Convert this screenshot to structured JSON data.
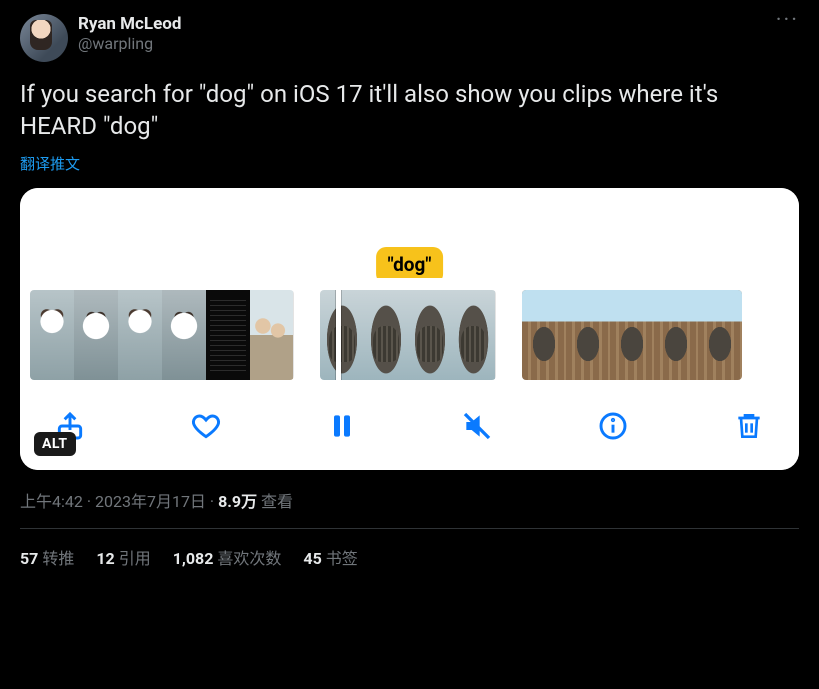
{
  "author": {
    "display_name": "Ryan McLeod",
    "handle": "@warpling"
  },
  "tweet_text": "If you search for \"dog\" on iOS 17 it'll also show you clips where it's HEARD \"dog\"",
  "translate_label": "翻译推文",
  "media": {
    "caption_badge": "\"dog\"",
    "alt_badge": "ALT"
  },
  "meta": {
    "time": "上午4:42",
    "date": "2023年7月17日",
    "views_count": "8.9万",
    "views_label": "查看"
  },
  "stats": {
    "retweets_count": "57",
    "retweets_label": "转推",
    "quotes_count": "12",
    "quotes_label": "引用",
    "likes_count": "1,082",
    "likes_label": "喜欢次数",
    "bookmarks_count": "45",
    "bookmarks_label": "书签"
  }
}
